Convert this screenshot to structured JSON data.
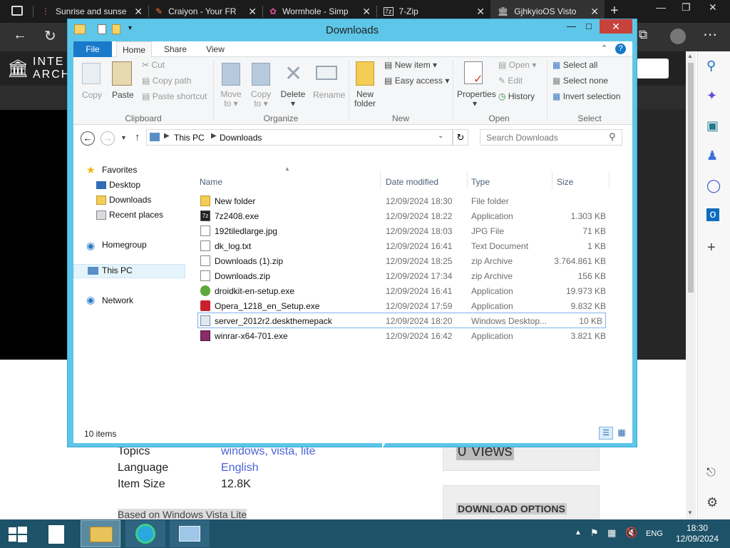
{
  "browser": {
    "tabs": [
      {
        "title": "Sunrise and sunse",
        "icon": "dots-icon"
      },
      {
        "title": "Craiyon - Your FR",
        "icon": "pencil-icon"
      },
      {
        "title": "Wormhole - Simp",
        "icon": "wormhole-icon"
      },
      {
        "title": "7-Zip",
        "icon": "7zip-icon"
      },
      {
        "title": "GjhkyioOS Visto",
        "icon": "archive-icon"
      }
    ],
    "site_logo_text_1": "INTE",
    "site_logo_text_2": "ARCH"
  },
  "webpage": {
    "meta": [
      {
        "label": "Topics",
        "value": "windows, vista, lite"
      },
      {
        "label": "Language",
        "value": "English"
      },
      {
        "label": "Item Size",
        "value": "12.8K"
      }
    ],
    "views_text": "0 Views",
    "download_options": "DOWNLOAD OPTIONS",
    "based_on": "Based on Windows Vista Lite"
  },
  "explorer": {
    "title": "Downloads",
    "ribbon_tabs": [
      "File",
      "Home",
      "Share",
      "View"
    ],
    "clipboard": {
      "copy": "Copy",
      "paste": "Paste",
      "cut": "Cut",
      "copy_path": "Copy path",
      "paste_shortcut": "Paste shortcut",
      "label": "Clipboard"
    },
    "organize": {
      "move_to_1": "Move",
      "move_to_2": "to",
      "copy_to_1": "Copy",
      "copy_to_2": "to",
      "delete": "Delete",
      "rename": "Rename",
      "label": "Organize"
    },
    "new": {
      "new_folder_1": "New",
      "new_folder_2": "folder",
      "new_item": "New item",
      "easy_access": "Easy access",
      "label": "New"
    },
    "open": {
      "properties": "Properties",
      "open": "Open",
      "edit": "Edit",
      "history": "History",
      "label": "Open"
    },
    "select": {
      "select_all": "Select all",
      "select_none": "Select none",
      "invert": "Invert selection",
      "label": "Select"
    },
    "address": {
      "crumb1": "This PC",
      "crumb2": "Downloads",
      "search_placeholder": "Search Downloads"
    },
    "nav": {
      "favorites": "Favorites",
      "desktop": "Desktop",
      "downloads": "Downloads",
      "recent": "Recent places",
      "homegroup": "Homegroup",
      "thispc": "This PC",
      "network": "Network"
    },
    "columns": {
      "name": "Name",
      "date": "Date modified",
      "type": "Type",
      "size": "Size"
    },
    "files": [
      {
        "name": "New folder",
        "date": "12/09/2024 18:30",
        "type": "File folder",
        "size": "",
        "icon": "folder-icon"
      },
      {
        "name": "7z2408.exe",
        "date": "12/09/2024 18:22",
        "type": "Application",
        "size": "1.303 KB",
        "icon": "7zip-app-icon"
      },
      {
        "name": "192tiledlarge.jpg",
        "date": "12/09/2024 18:03",
        "type": "JPG File",
        "size": "71 KB",
        "icon": "image-file-icon"
      },
      {
        "name": "dk_log.txt",
        "date": "12/09/2024 16:41",
        "type": "Text Document",
        "size": "1 KB",
        "icon": "text-file-icon"
      },
      {
        "name": "Downloads (1).zip",
        "date": "12/09/2024 18:25",
        "type": "zip Archive",
        "size": "3.764.861 KB",
        "icon": "zip-file-icon"
      },
      {
        "name": "Downloads.zip",
        "date": "12/09/2024 17:34",
        "type": "zip Archive",
        "size": "156 KB",
        "icon": "zip-file-icon"
      },
      {
        "name": "droidkit-en-setup.exe",
        "date": "12/09/2024 16:41",
        "type": "Application",
        "size": "19.973 KB",
        "icon": "droidkit-app-icon"
      },
      {
        "name": "Opera_1218_en_Setup.exe",
        "date": "12/09/2024 17:59",
        "type": "Application",
        "size": "9.832 KB",
        "icon": "opera-app-icon"
      },
      {
        "name": "server_2012r2.deskthemepack",
        "date": "12/09/2024 18:20",
        "type": "Windows Desktop...",
        "size": "10 KB",
        "icon": "themepack-icon"
      },
      {
        "name": "winrar-x64-701.exe",
        "date": "12/09/2024 16:42",
        "type": "Application",
        "size": "3.821 KB",
        "icon": "winrar-app-icon"
      }
    ],
    "status": "10 items"
  },
  "taskbar": {
    "lang": "ENG",
    "time": "18:30",
    "date": "12/09/2024"
  },
  "colors": {
    "window_frame": "#5ec6e8",
    "close_red": "#c7423a",
    "file_tab": "#1979ca",
    "taskbar": "#1e5268",
    "link": "#4a64d8"
  }
}
